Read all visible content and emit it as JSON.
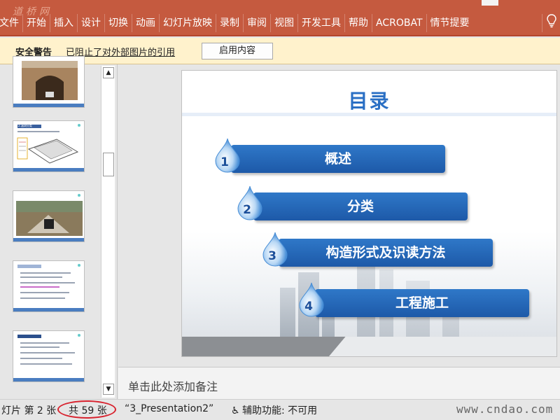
{
  "app": {
    "logo_text": "道桥网"
  },
  "ribbon": {
    "tabs": [
      "文件",
      "开始",
      "插入",
      "设计",
      "切换",
      "动画",
      "幻灯片放映",
      "录制",
      "审阅",
      "视图",
      "开发工具",
      "帮助",
      "ACROBAT",
      "情节提要"
    ],
    "tell_me_icon": "lightbulb-icon"
  },
  "security_bar": {
    "title": "安全警告",
    "message": "已阻止了对外部图片的引用",
    "button": "启用内容"
  },
  "slide": {
    "title": "目录",
    "items": [
      {
        "number": "1",
        "label": "概述"
      },
      {
        "number": "2",
        "label": "分类"
      },
      {
        "number": "3",
        "label": "构造形式及识读方法"
      },
      {
        "number": "4",
        "label": "工程施工"
      }
    ]
  },
  "thumbnails": {
    "slide_2_heading": "2.涵洞分类"
  },
  "notes": {
    "placeholder": "单击此处添加备注"
  },
  "status_bar": {
    "slide_position": "灯片 第 2 张",
    "slide_total": "共 59 张",
    "theme_name": "“3_Presentation2”",
    "accessibility": "辅助功能: 不可用",
    "watermark": "www.cndao.com"
  },
  "colors": {
    "ribbon": "#c55a3f",
    "security_bar": "#fff2cc",
    "bar_blue": "#1d59a8",
    "title_blue": "#2a6fc4",
    "highlight_circle": "#d8222e"
  }
}
